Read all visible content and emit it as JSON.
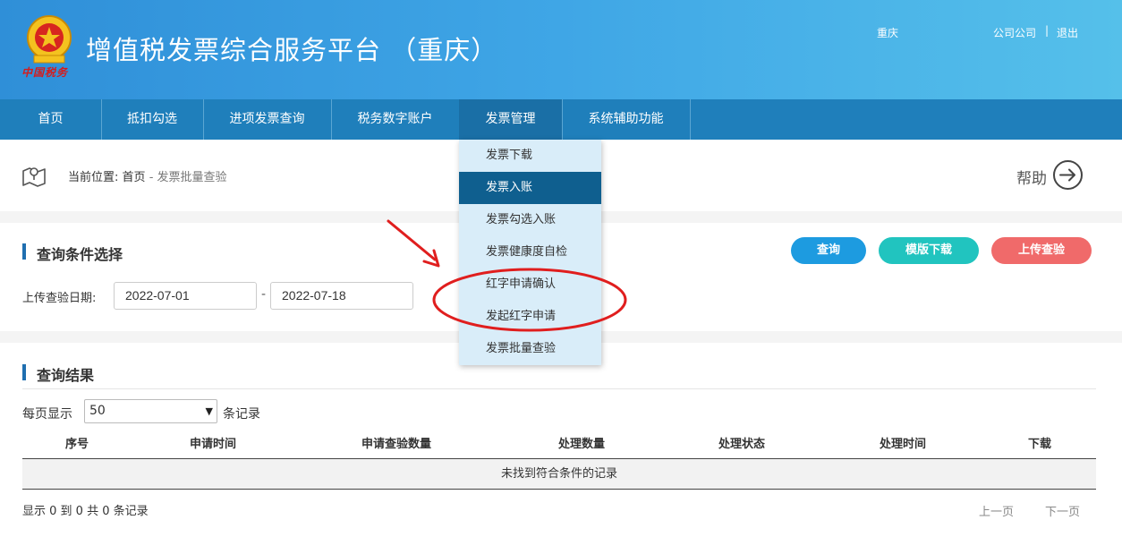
{
  "header": {
    "title": "增值税发票综合服务平台 （重庆）",
    "emblem_caption": "中国税务",
    "user_region": "重庆",
    "user_company": "公司公司",
    "separator": "|",
    "logout": "退出"
  },
  "nav": [
    {
      "label": "首页"
    },
    {
      "label": "抵扣勾选"
    },
    {
      "label": "进项发票查询"
    },
    {
      "label": "税务数字账户"
    },
    {
      "label": "发票管理"
    },
    {
      "label": "系统辅助功能"
    }
  ],
  "dropdown": [
    {
      "label": "发票下载"
    },
    {
      "label": "发票入账"
    },
    {
      "label": "发票勾选入账"
    },
    {
      "label": "发票健康度自检"
    },
    {
      "label": "红字申请确认"
    },
    {
      "label": "发起红字申请"
    },
    {
      "label": "发票批量查验"
    }
  ],
  "breadcrumb": {
    "prefix": "当前位置:",
    "home": "首页",
    "separator": "-",
    "current": "发票批量查验"
  },
  "help": "帮助",
  "query": {
    "title": "查询条件选择",
    "date_label": "上传查验日期:",
    "start_date": "2022-07-01",
    "end_date": "2022-07-18",
    "dash": "-",
    "btn_query": "查询",
    "btn_template": "模版下载",
    "btn_upload": "上传查验"
  },
  "results": {
    "title": "查询结果",
    "per_page_prefix": "每页显示",
    "per_page_value": "50",
    "per_page_suffix": "条记录",
    "columns": [
      "序号",
      "申请时间",
      "申请查验数量",
      "处理数量",
      "处理状态",
      "处理时间",
      "下载"
    ],
    "empty_message": "未找到符合条件的记录",
    "summary": "显示 0 到 0 共 0 条记录",
    "prev": "上一页",
    "next": "下一页"
  },
  "colors": {
    "header_start": "#2f8fd8",
    "header_end": "#55c0ea",
    "nav_bg": "#1f7fbb",
    "dropdown_bg": "#d9edf9",
    "dropdown_active": "#0f5f8f",
    "btn_query": "#1d9be0",
    "btn_template": "#21c4bf",
    "btn_upload": "#f06a6a",
    "annotation": "#e01e1e"
  }
}
